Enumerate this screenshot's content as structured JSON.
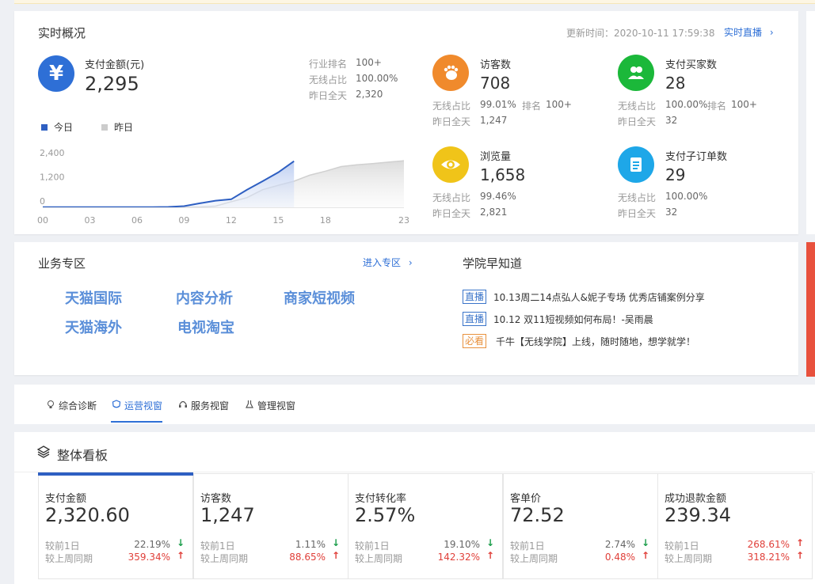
{
  "realtime": {
    "title": "实时概况",
    "update_label": "更新时间：2020-10-11 17:59:38",
    "live_link": "实时直播",
    "pay_amount": {
      "label": "支付金额(元)",
      "value": "2,295",
      "icon": "yuan-icon"
    },
    "pay_stats": [
      {
        "label": "行业排名",
        "value": "100+"
      },
      {
        "label": "无线占比",
        "value": "100.00%"
      },
      {
        "label": "昨日全天",
        "value": "2,320"
      }
    ],
    "legend": {
      "today": "今日",
      "yesterday": "昨日"
    },
    "kpis": [
      {
        "icon": "footprint-icon",
        "color": "#f08a2c",
        "title": "访客数",
        "value": "708",
        "r1_label": "无线占比",
        "r1_value": "99.01%",
        "rank_label": "排名",
        "rank_value": "100+",
        "r2_label": "昨日全天",
        "r2_value": "1,247"
      },
      {
        "icon": "buyers-icon",
        "color": "#1bb83a",
        "title": "支付买家数",
        "value": "28",
        "r1_label": "无线占比",
        "r1_value": "100.00%",
        "rank_label": "排名",
        "rank_value": "100+",
        "r2_label": "昨日全天",
        "r2_value": "32"
      },
      {
        "icon": "eye-icon",
        "color": "#f0c419",
        "title": "浏览量",
        "value": "1,658",
        "r1_label": "无线占比",
        "r1_value": "99.46%",
        "rank_label": "",
        "rank_value": "",
        "r2_label": "昨日全天",
        "r2_value": "2,821"
      },
      {
        "icon": "order-icon",
        "color": "#1ea7e8",
        "title": "支付子订单数",
        "value": "29",
        "r1_label": "无线占比",
        "r1_value": "100.00%",
        "rank_label": "",
        "rank_value": "",
        "r2_label": "昨日全天",
        "r2_value": "32"
      }
    ]
  },
  "chart_data": {
    "type": "area",
    "x": [
      0,
      1,
      2,
      3,
      4,
      5,
      6,
      7,
      8,
      9,
      10,
      11,
      12,
      13,
      14,
      15,
      16,
      17,
      18,
      19,
      20,
      21,
      22,
      23
    ],
    "xticks": [
      "00",
      "03",
      "06",
      "09",
      "12",
      "15",
      "18",
      "23"
    ],
    "xtick_values": [
      0,
      3,
      6,
      9,
      12,
      15,
      18,
      23
    ],
    "yticks": [
      "2,400",
      "1,200",
      "0"
    ],
    "ytick_values": [
      2400,
      1200,
      0
    ],
    "ylim": [
      0,
      2600
    ],
    "xlim": [
      0,
      23
    ],
    "series": [
      {
        "name": "今日",
        "color": "#2e5fc2",
        "values": [
          10,
          10,
          10,
          10,
          10,
          10,
          10,
          10,
          20,
          60,
          200,
          330,
          400,
          870,
          1300,
          1740,
          2295
        ]
      },
      {
        "name": "昨日",
        "color": "#cccccc",
        "values": [
          10,
          10,
          10,
          10,
          10,
          10,
          10,
          10,
          10,
          10,
          20,
          60,
          280,
          480,
          880,
          1100,
          1300,
          1600,
          1800,
          2030,
          2120,
          2180,
          2250,
          2320
        ]
      }
    ]
  },
  "business": {
    "title": "业务专区",
    "enter_link": "进入专区",
    "items": [
      "天猫国际",
      "内容分析",
      "商家短视频",
      "天猫海外",
      "电视淘宝"
    ]
  },
  "academy": {
    "title": "学院早知道",
    "news": [
      {
        "tag": "直播",
        "text": "10.13周二14点弘人&妮子专场 优秀店铺案例分享"
      },
      {
        "tag": "直播",
        "text": "10.12 双11短视频如何布局！-吴雨晨"
      },
      {
        "tag": "必看",
        "text": "千牛【无线学院】上线，随时随地，想学就学！"
      }
    ]
  },
  "tabs": [
    {
      "label": "综合诊断",
      "icon": "bulb-icon"
    },
    {
      "label": "运营视窗",
      "icon": "shield-icon",
      "active": true
    },
    {
      "label": "服务视窗",
      "icon": "headset-icon"
    },
    {
      "label": "管理视窗",
      "icon": "flask-icon"
    }
  ],
  "board": {
    "title": "整体看板",
    "metrics": [
      {
        "title": "支付金额",
        "value": "2,320.60",
        "r1_label": "较前1日",
        "r1_value": "22.19%",
        "r1_dir": "down",
        "r2_label": "较上周同期",
        "r2_value": "359.34%",
        "r2_dir": "up"
      },
      {
        "title": "访客数",
        "value": "1,247",
        "r1_label": "较前1日",
        "r1_value": "1.11%",
        "r1_dir": "down",
        "r2_label": "较上周同期",
        "r2_value": "88.65%",
        "r2_dir": "up"
      },
      {
        "title": "支付转化率",
        "value": "2.57%",
        "r1_label": "较前1日",
        "r1_value": "19.10%",
        "r1_dir": "down",
        "r2_label": "较上周同期",
        "r2_value": "142.32%",
        "r2_dir": "up"
      },
      {
        "title": "客单价",
        "value": "72.52",
        "r1_label": "较前1日",
        "r1_value": "2.74%",
        "r1_dir": "down",
        "r2_label": "较上周同期",
        "r2_value": "0.48%",
        "r2_dir": "up"
      },
      {
        "title": "成功退款金额",
        "value": "239.34",
        "r1_label": "较前1日",
        "r1_value": "268.61%",
        "r1_dir": "up",
        "r2_label": "较上周同期",
        "r2_value": "318.21%",
        "r2_dir": "up"
      }
    ]
  },
  "colors": {
    "accent": "#2e5fc2",
    "up": "#e0403a",
    "down": "#1a9d4a"
  }
}
